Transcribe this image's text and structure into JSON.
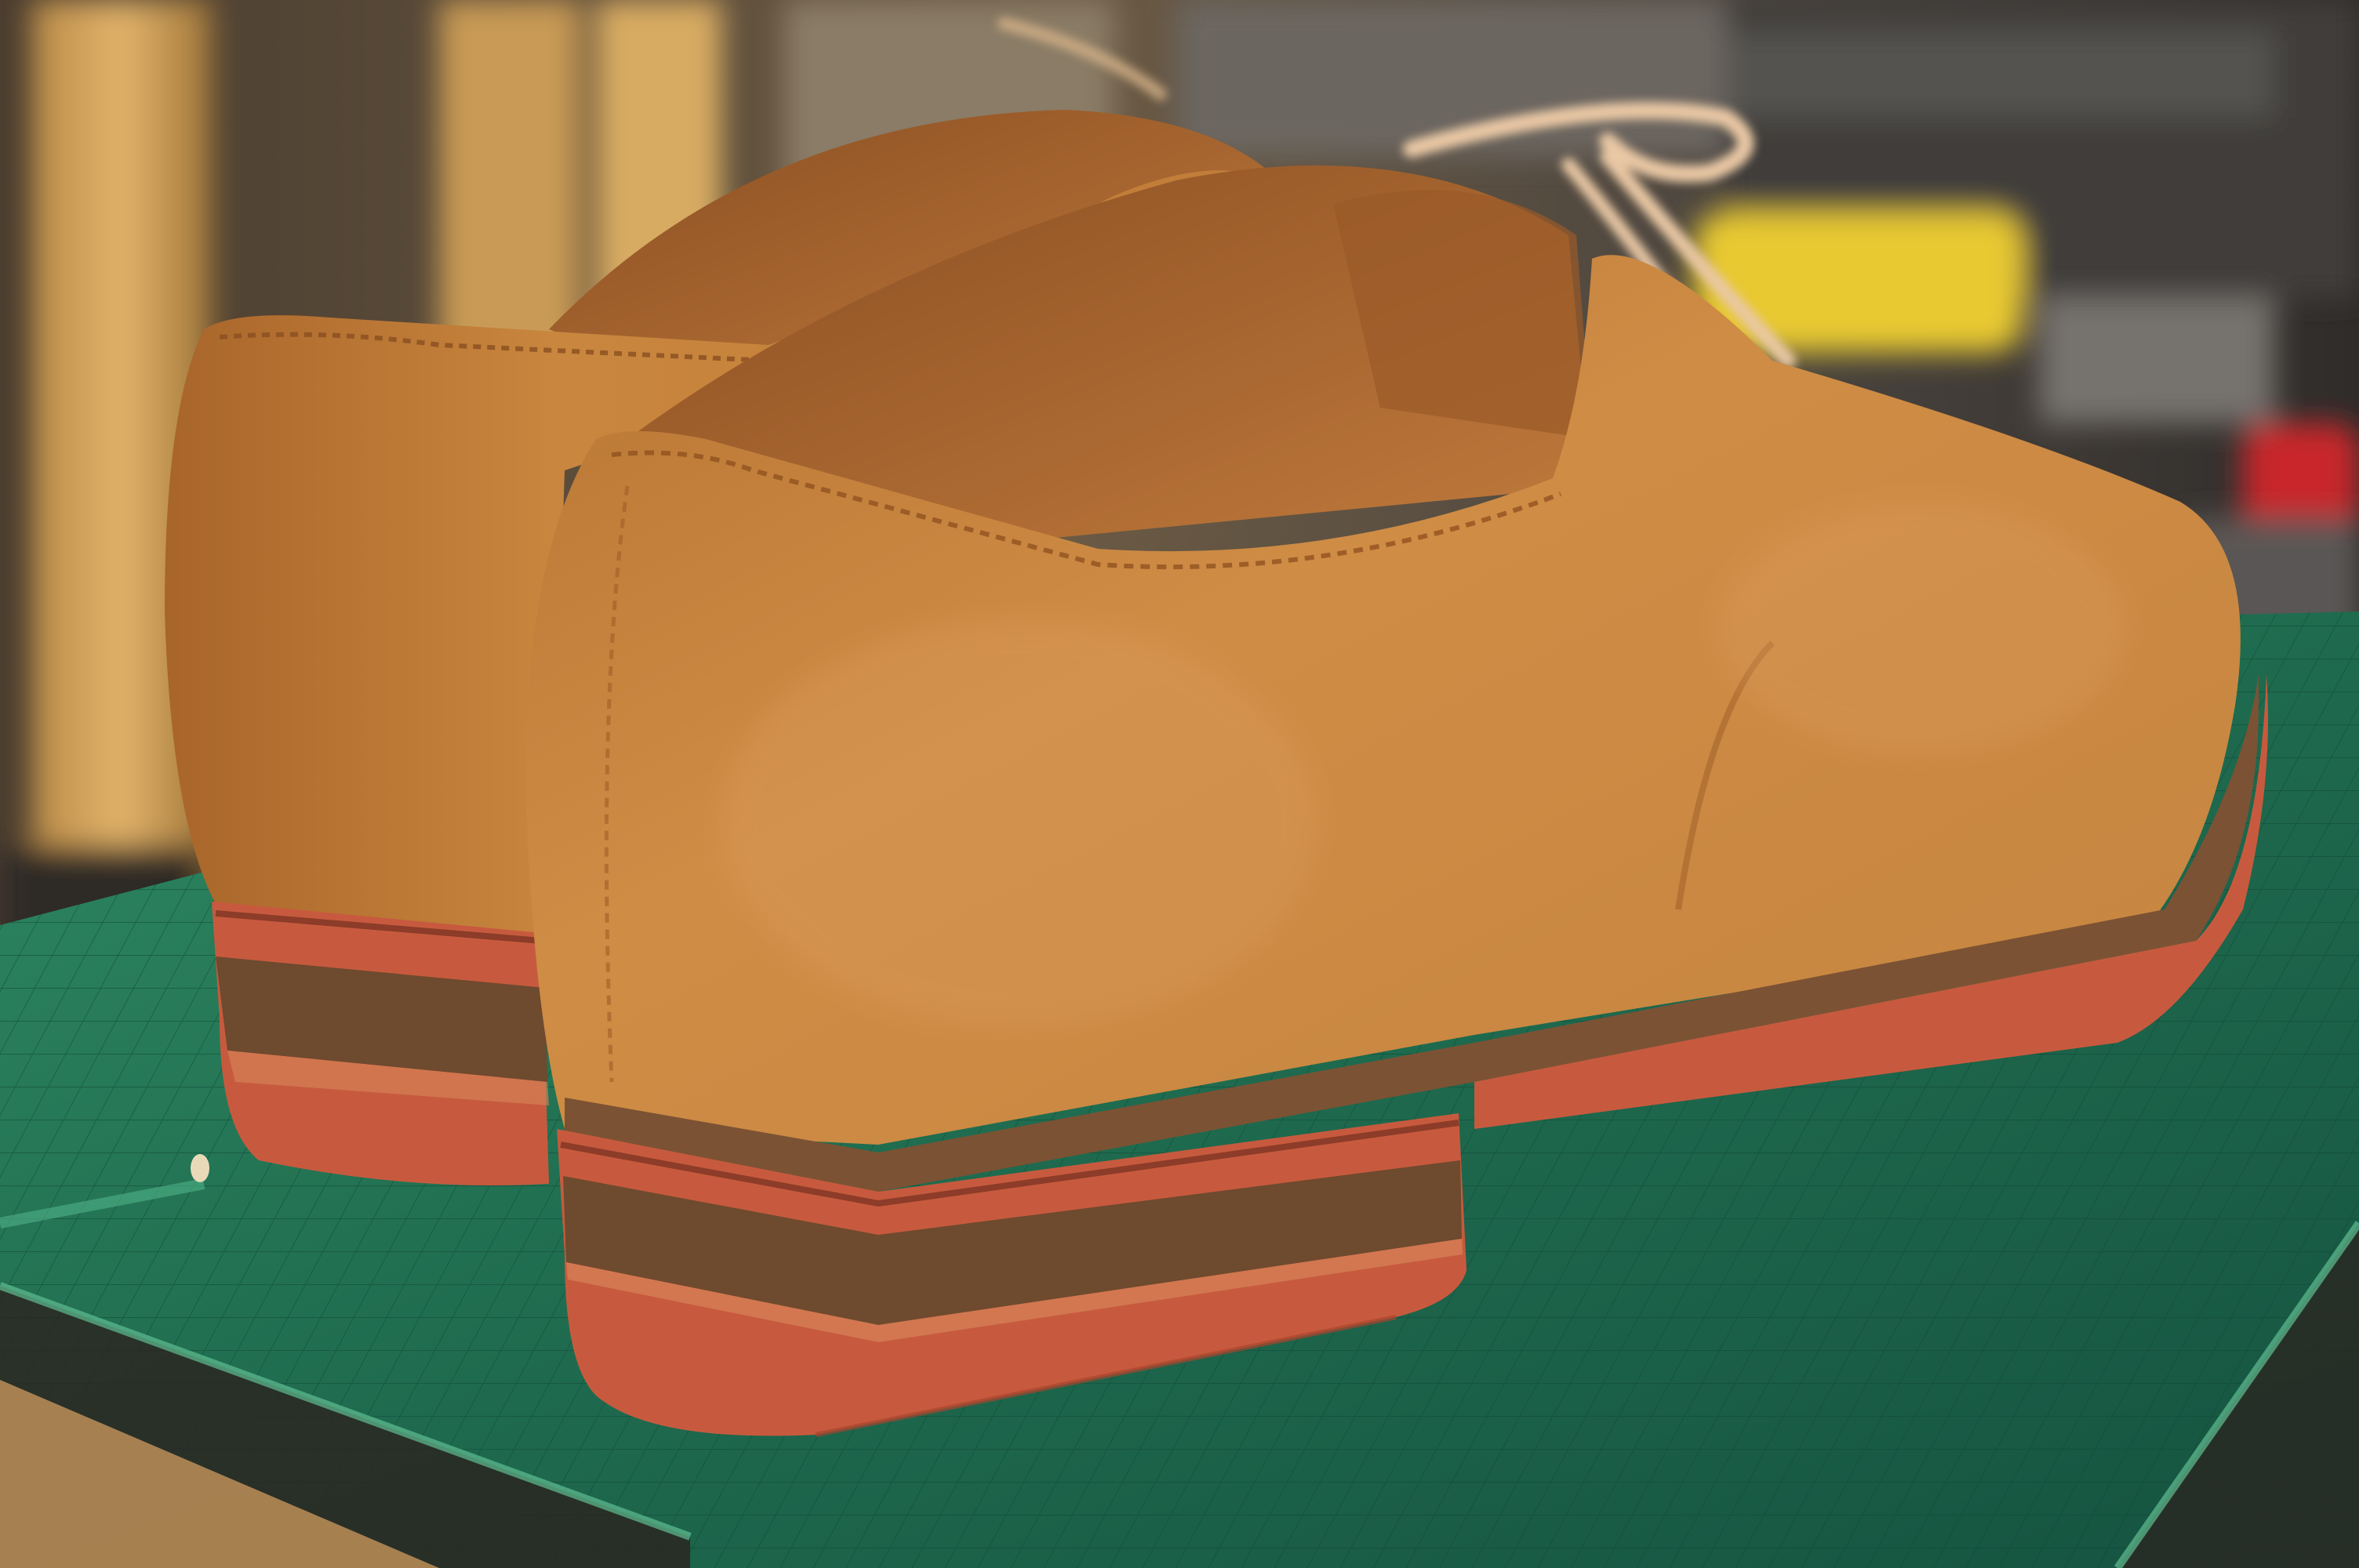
{
  "photo": {
    "subject": "suede-shoes-pair",
    "palette": {
      "suede": "#c9863e",
      "suede_dark": "#9e5e26",
      "suede_light": "#dea161",
      "lining": "#b06a30",
      "sole_red": "#c75a3e",
      "heel_wood": "#6e4a2e",
      "mat_green": "#1f6b4f",
      "mat_light": "#3a9c6f",
      "laces": "#e9c8a4",
      "background_dark": "#3d3630",
      "wood_panel": "#d9a85a",
      "yellow_object": "#e8c930",
      "red_object": "#c8262a"
    }
  }
}
